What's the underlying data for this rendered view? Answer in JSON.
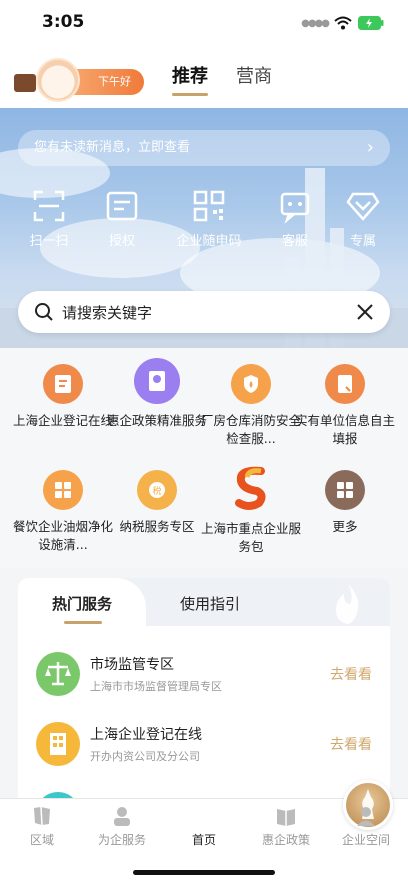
{
  "status": {
    "time": "3:05"
  },
  "header": {
    "greeting": "下午好",
    "tabs": [
      {
        "label": "推荐",
        "active": true
      },
      {
        "label": "营商",
        "active": false
      }
    ]
  },
  "banner": {
    "message": "您有未读新消息，立即查看",
    "quick": [
      {
        "label": "扫一扫",
        "icon": "scan-icon"
      },
      {
        "label": "授权",
        "icon": "authorize-icon"
      },
      {
        "label": "企业随申码",
        "icon": "qr-code-icon"
      },
      {
        "label": "客服",
        "icon": "customer-service-icon"
      },
      {
        "label": "专属",
        "icon": "diamond-icon"
      }
    ],
    "search_placeholder": "请搜索关键字"
  },
  "services": [
    {
      "label": "上海企业登记在线",
      "icon": "registration-icon",
      "color": "#f08a4b"
    },
    {
      "label": "惠企政策精准服务",
      "icon": "policy-icon",
      "color": "#9b7ef0"
    },
    {
      "label": "厂房仓库消防安全检查服...",
      "icon": "fire-safety-icon",
      "color": "#f5a24a"
    },
    {
      "label": "实有单位信息自主填报",
      "icon": "report-icon",
      "color": "#f08a4b"
    },
    {
      "label": "餐饮企业油烟净化设施清...",
      "icon": "grid-icon",
      "color": "#f5a24a"
    },
    {
      "label": "纳税服务专区",
      "icon": "tax-icon",
      "color": "#f5b24a"
    },
    {
      "label": "上海市重点企业服务包",
      "icon": "brand-s-icon",
      "color": "#e8521f"
    },
    {
      "label": "更多",
      "icon": "more-icon",
      "color": "#8a6a5a"
    }
  ],
  "card": {
    "tabs": [
      "热门服务",
      "使用指引"
    ],
    "rows": [
      {
        "title": "市场监管专区",
        "sub": "上海市市场监督管理局专区",
        "action": "去看看",
        "color": "#7bc86a"
      },
      {
        "title": "上海企业登记在线",
        "sub": "开办内资公司及分公司",
        "action": "去看看",
        "color": "#f5b83a"
      }
    ]
  },
  "nav": [
    {
      "label": "区域",
      "icon": "region-icon"
    },
    {
      "label": "为企服务",
      "icon": "enterprise-service-icon"
    },
    {
      "label": "首页",
      "icon": "home-icon",
      "active": true
    },
    {
      "label": "惠企政策",
      "icon": "policy-book-icon"
    },
    {
      "label": "企业空间",
      "icon": "profile-icon"
    }
  ]
}
